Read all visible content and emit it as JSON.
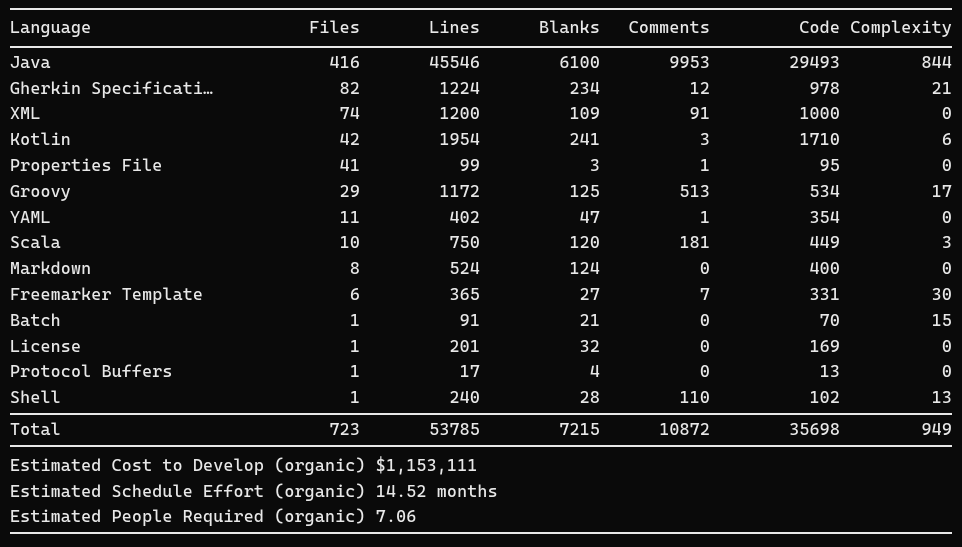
{
  "columns": {
    "language": "Language",
    "files": "Files",
    "lines": "Lines",
    "blanks": "Blanks",
    "comments": "Comments",
    "code": "Code",
    "complexity": "Complexity"
  },
  "rows": [
    {
      "language": "Java",
      "files": 416,
      "lines": 45546,
      "blanks": 6100,
      "comments": 9953,
      "code": 29493,
      "complexity": 844
    },
    {
      "language": "Gherkin Specificati…",
      "files": 82,
      "lines": 1224,
      "blanks": 234,
      "comments": 12,
      "code": 978,
      "complexity": 21
    },
    {
      "language": "XML",
      "files": 74,
      "lines": 1200,
      "blanks": 109,
      "comments": 91,
      "code": 1000,
      "complexity": 0
    },
    {
      "language": "Kotlin",
      "files": 42,
      "lines": 1954,
      "blanks": 241,
      "comments": 3,
      "code": 1710,
      "complexity": 6
    },
    {
      "language": "Properties File",
      "files": 41,
      "lines": 99,
      "blanks": 3,
      "comments": 1,
      "code": 95,
      "complexity": 0
    },
    {
      "language": "Groovy",
      "files": 29,
      "lines": 1172,
      "blanks": 125,
      "comments": 513,
      "code": 534,
      "complexity": 17
    },
    {
      "language": "YAML",
      "files": 11,
      "lines": 402,
      "blanks": 47,
      "comments": 1,
      "code": 354,
      "complexity": 0
    },
    {
      "language": "Scala",
      "files": 10,
      "lines": 750,
      "blanks": 120,
      "comments": 181,
      "code": 449,
      "complexity": 3
    },
    {
      "language": "Markdown",
      "files": 8,
      "lines": 524,
      "blanks": 124,
      "comments": 0,
      "code": 400,
      "complexity": 0
    },
    {
      "language": "Freemarker Template",
      "files": 6,
      "lines": 365,
      "blanks": 27,
      "comments": 7,
      "code": 331,
      "complexity": 30
    },
    {
      "language": "Batch",
      "files": 1,
      "lines": 91,
      "blanks": 21,
      "comments": 0,
      "code": 70,
      "complexity": 15
    },
    {
      "language": "License",
      "files": 1,
      "lines": 201,
      "blanks": 32,
      "comments": 0,
      "code": 169,
      "complexity": 0
    },
    {
      "language": "Protocol Buffers",
      "files": 1,
      "lines": 17,
      "blanks": 4,
      "comments": 0,
      "code": 13,
      "complexity": 0
    },
    {
      "language": "Shell",
      "files": 1,
      "lines": 240,
      "blanks": 28,
      "comments": 110,
      "code": 102,
      "complexity": 13
    }
  ],
  "total": {
    "label": "Total",
    "files": 723,
    "lines": 53785,
    "blanks": 7215,
    "comments": 10872,
    "code": 35698,
    "complexity": 949
  },
  "estimates": {
    "cost": "Estimated Cost to Develop (organic) $1,153,111",
    "schedule": "Estimated Schedule Effort (organic) 14.52 months",
    "people": "Estimated People Required (organic) 7.06"
  }
}
